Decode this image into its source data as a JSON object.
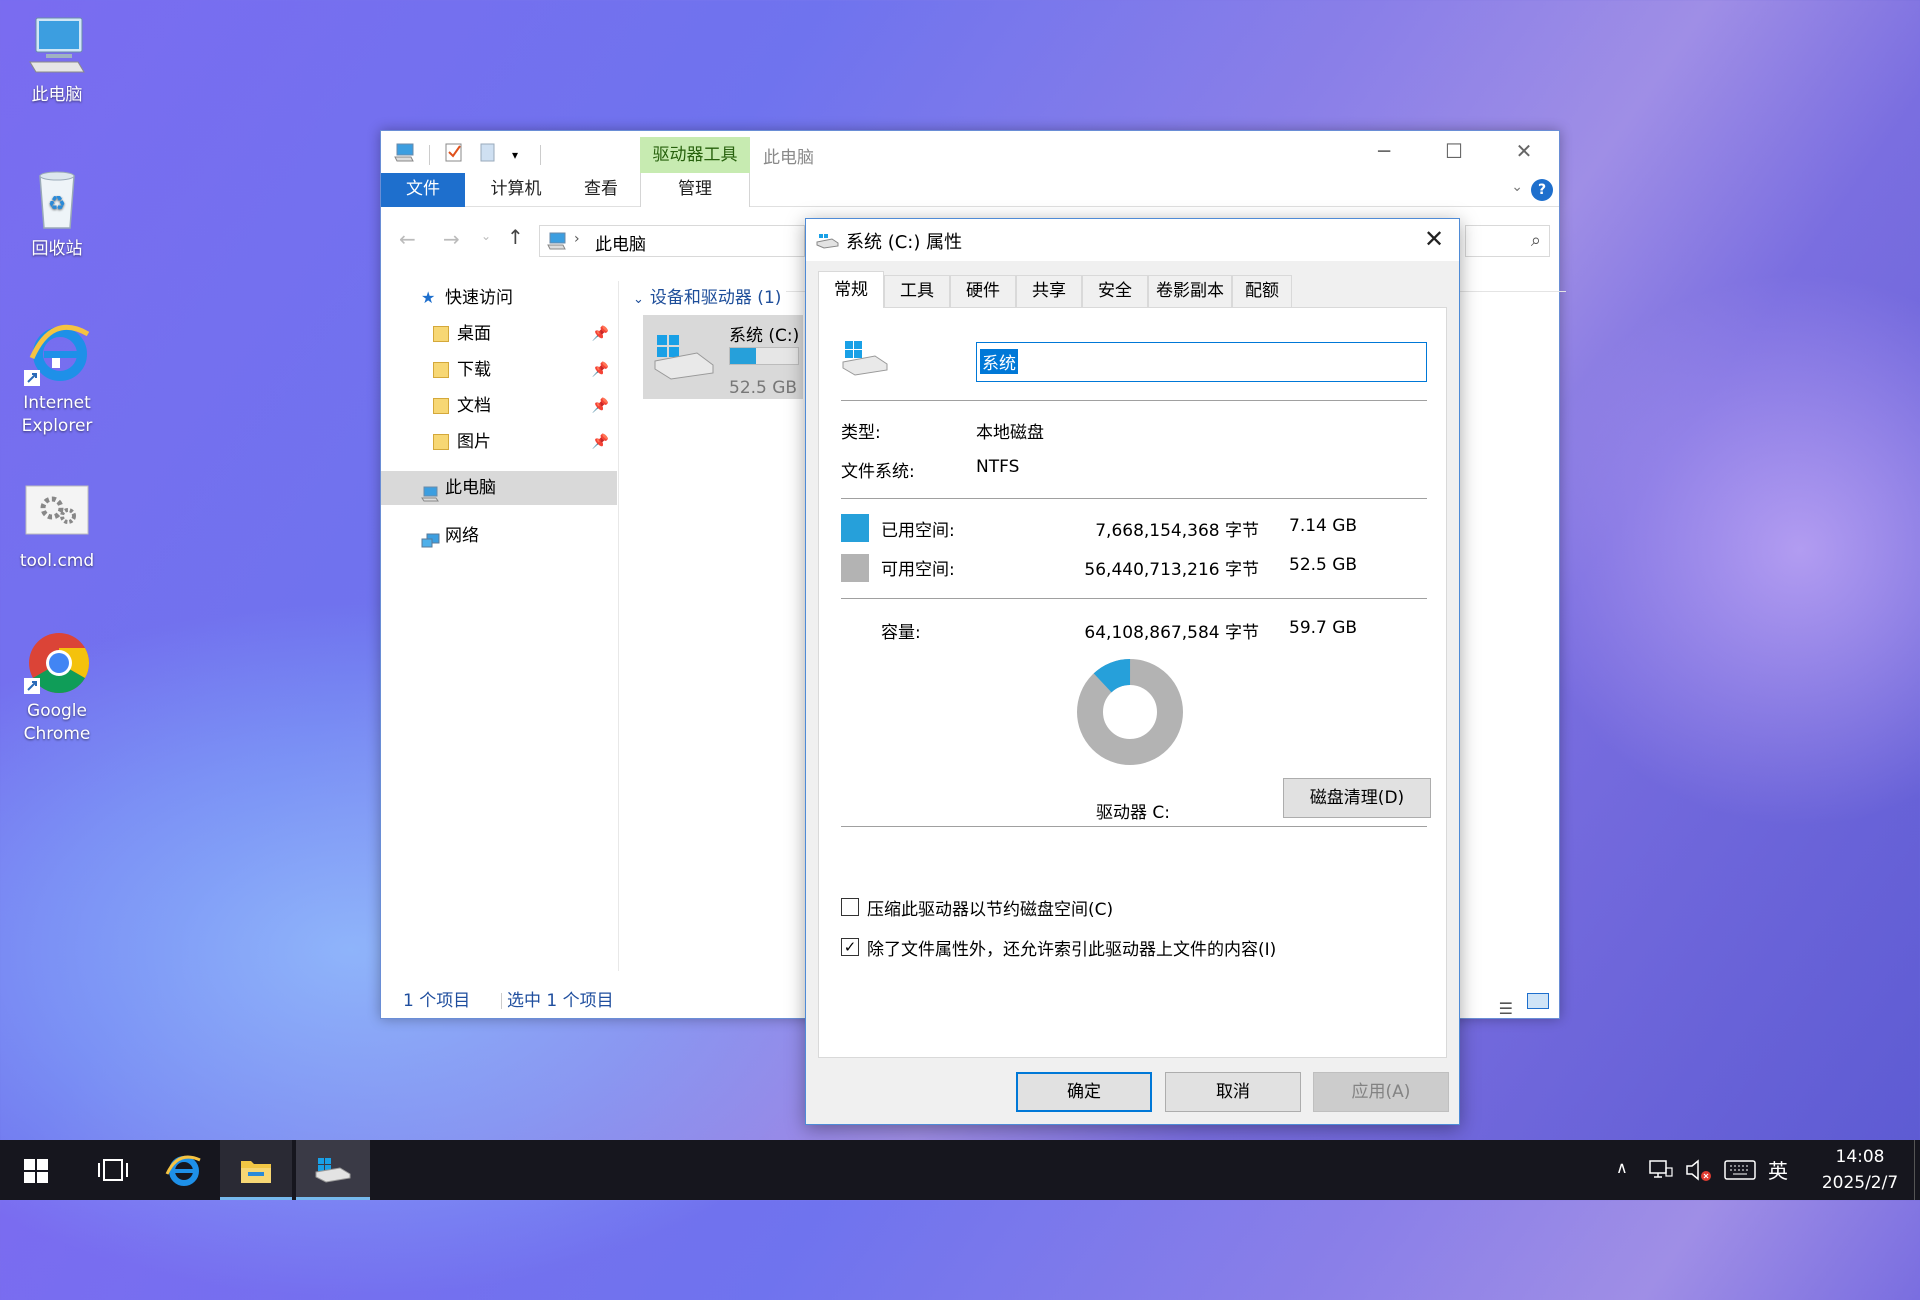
{
  "desktop": {
    "icons": [
      {
        "label": "此电脑",
        "icon": "computer-icon"
      },
      {
        "label": "回收站",
        "icon": "recycle-bin-icon"
      },
      {
        "label": "Internet Explorer",
        "icon": "internet-explorer-icon"
      },
      {
        "label": "tool.cmd",
        "icon": "cmd-file-icon"
      },
      {
        "label": "Google Chrome",
        "icon": "chrome-icon"
      }
    ]
  },
  "explorer": {
    "title": "此电脑",
    "context_tab": "驱动器工具",
    "ribbon_tabs": [
      "文件",
      "计算机",
      "查看",
      "管理"
    ],
    "address": "此电脑",
    "nav": {
      "quick_access": "快速访问",
      "items": [
        {
          "label": "桌面",
          "pinned": true
        },
        {
          "label": "下载",
          "pinned": true
        },
        {
          "label": "文档",
          "pinned": true
        },
        {
          "label": "图片",
          "pinned": true
        }
      ],
      "this_pc": "此电脑",
      "network": "网络"
    },
    "group_header": "设备和驱动器 (1)",
    "drive": {
      "name": "系统 (C:)",
      "free_text": "52.5 GB 可",
      "used_fraction": 0.12
    },
    "status": {
      "count": "1 个项目",
      "selected": "选中 1 个项目"
    }
  },
  "dialog": {
    "title": "系统 (C:) 属性",
    "tabs": [
      "常规",
      "工具",
      "硬件",
      "共享",
      "安全",
      "卷影副本",
      "配额"
    ],
    "active_tab": "常规",
    "name_value": "系统",
    "type_label": "类型:",
    "type_value": "本地磁盘",
    "fs_label": "文件系统:",
    "fs_value": "NTFS",
    "used_label": "已用空间:",
    "used_bytes": "7,668,154,368 字节",
    "used_size": "7.14 GB",
    "free_label": "可用空间:",
    "free_bytes": "56,440,713,216 字节",
    "free_size": "52.5 GB",
    "cap_label": "容量:",
    "cap_bytes": "64,108,867,584 字节",
    "cap_size": "59.7 GB",
    "used_fraction": 0.12,
    "drive_label": "驱动器 C:",
    "cleanup_button": "磁盘清理(D)",
    "compress_label": "压缩此驱动器以节约磁盘空间(C)",
    "compress_checked": false,
    "index_label": "除了文件属性外，还允许索引此驱动器上文件的内容(I)",
    "index_checked": true,
    "ok": "确定",
    "cancel": "取消",
    "apply": "应用(A)",
    "colors": {
      "used": "#26a0da",
      "free": "#b3b3b3"
    }
  },
  "taskbar": {
    "time": "14:08",
    "date": "2025/2/7",
    "ime": "英"
  }
}
